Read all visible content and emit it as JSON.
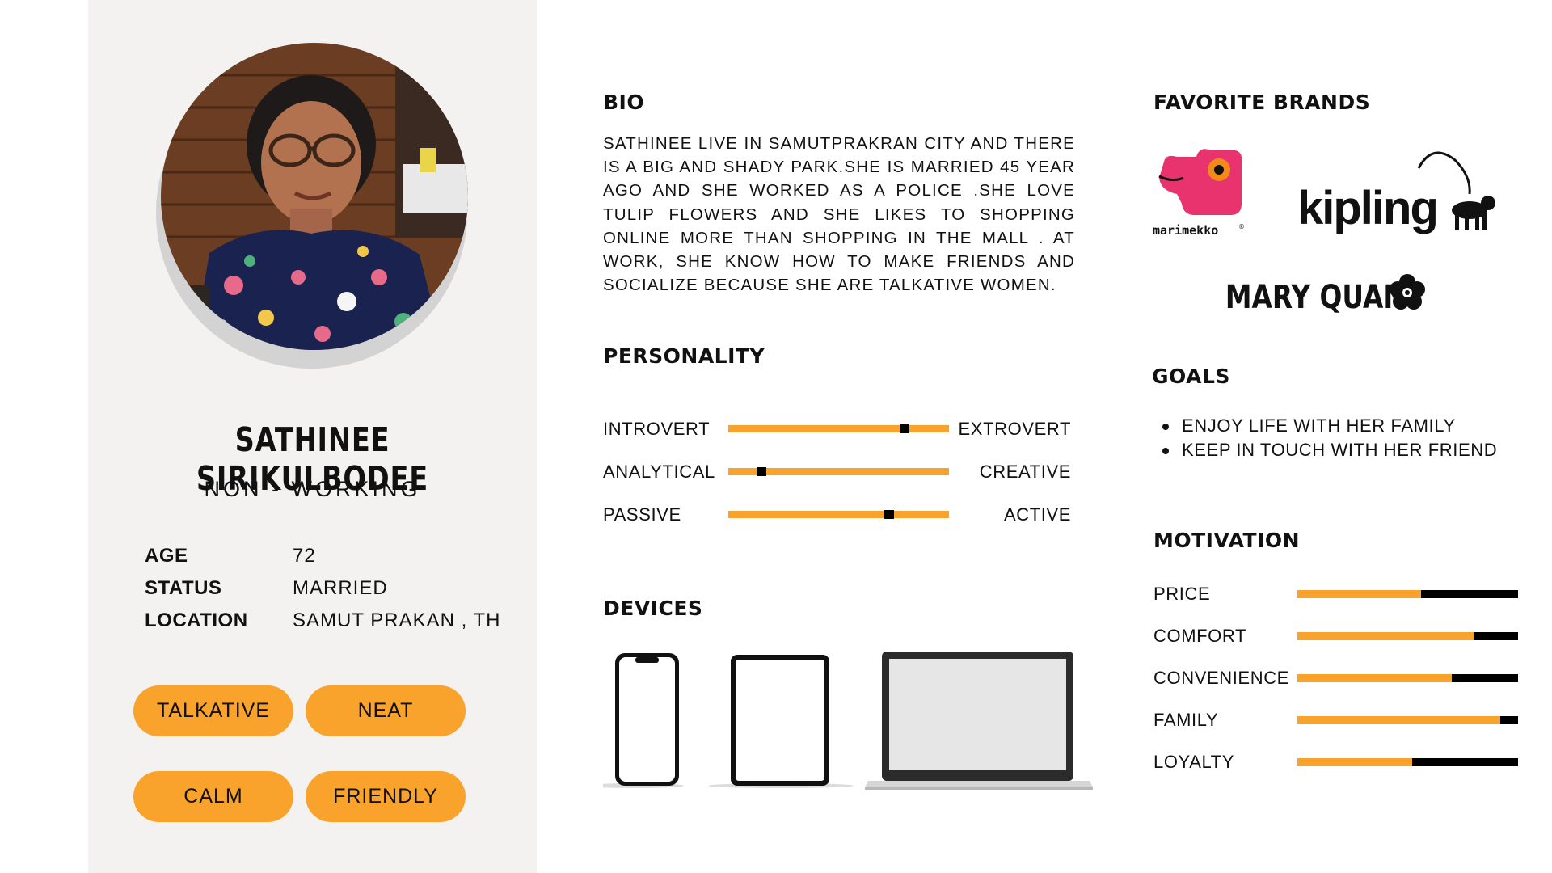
{
  "profile": {
    "name": "SATHINEE SIRIKULBODEE",
    "role": "NON - WORKING",
    "facts": [
      {
        "key": "AGE",
        "value": "72"
      },
      {
        "key": "STATUS",
        "value": "MARRIED"
      },
      {
        "key": "LOCATION",
        "value": "SAMUT PRAKAN , TH"
      }
    ],
    "traits": [
      "TALKATIVE",
      "NEAT",
      "CALM",
      "FRIENDLY"
    ]
  },
  "bio": {
    "heading": "BIO",
    "text": "SATHINEE LIVE IN SAMUTPRAKRAN CITY  AND THERE IS A BIG AND SHADY PARK.SHE IS MARRIED 45 YEAR AGO AND SHE WORKED AS A POLICE .SHE LOVE TULIP FLOWERS AND SHE LIKES TO SHOPPING ONLINE MORE THAN SHOPPING IN THE MALL . AT WORK, SHE KNOW HOW TO MAKE FRIENDS AND SOCIALIZE BECAUSE SHE ARE TALKATIVE WOMEN."
  },
  "personality": {
    "heading": "PERSONALITY",
    "scales": [
      {
        "left": "INTROVERT",
        "right": "EXTROVERT",
        "level": 0.8
      },
      {
        "left": "ANALYTICAL",
        "right": "CREATIVE",
        "level": 0.15
      },
      {
        "left": "PASSIVE",
        "right": "ACTIVE",
        "level": 0.73
      }
    ]
  },
  "devices": {
    "heading": "DEVICES",
    "items": [
      "phone-icon",
      "tablet-icon",
      "laptop-icon"
    ]
  },
  "brands": {
    "heading": "FAVORITE BRANDS",
    "logos": [
      {
        "name": "marimekko",
        "text": "marimekko",
        "mark": "®",
        "accent": "#e8336e"
      },
      {
        "name": "kipling",
        "text": "kipling"
      },
      {
        "name": "mary-quant",
        "text": "MARY QUANT"
      }
    ]
  },
  "goals": {
    "heading": "GOALS",
    "items": [
      "ENJOY LIFE WITH HER FAMILY",
      "KEEP IN TOUCH WITH HER FRIEND"
    ]
  },
  "motivation": {
    "heading": "MOTIVATION",
    "items": [
      {
        "label": "PRICE",
        "level": 0.56
      },
      {
        "label": "COMFORT",
        "level": 0.8
      },
      {
        "label": "CONVENIENCE",
        "level": 0.7
      },
      {
        "label": "FAMILY",
        "level": 0.92
      },
      {
        "label": "LOYALTY",
        "level": 0.52
      }
    ]
  },
  "colors": {
    "accent": "#f9a22c",
    "panel": "#f3f2f1",
    "dark": "#000000"
  }
}
